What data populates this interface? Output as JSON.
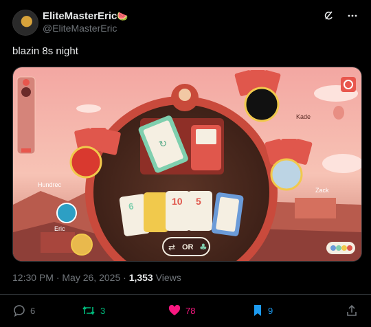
{
  "user": {
    "display_name": "EliteMasterEric",
    "emoji": "🍉",
    "handle": "@EliteMasterEric"
  },
  "tweet": {
    "text": "blazin 8s night",
    "time": "12:30 PM",
    "separator": "·",
    "date": "May 26, 2025",
    "separator2": "·",
    "views_count": "1,353",
    "views_label": "Views"
  },
  "actions": {
    "replies": "6",
    "retweets": "3",
    "likes": "78",
    "bookmarks": "9"
  },
  "game": {
    "players": {
      "kade": "Kade",
      "zack": "Zack",
      "hundrec": "Hundrec",
      "eric": "Eric"
    },
    "hand_cards": [
      "6",
      "",
      "10",
      "5",
      ""
    ],
    "wild_label": "OR",
    "colors": {
      "red": "#e0574c",
      "green": "#7fcfae",
      "blue": "#6b9bd8",
      "yellow": "#f1c94c",
      "ring": "#c94a3c"
    }
  },
  "icons": {
    "grok": "grok-icon",
    "more": "more-icon",
    "reply": "reply-icon",
    "retweet": "retweet-icon",
    "like": "heart-icon",
    "bookmark": "bookmark-icon",
    "share": "share-icon"
  }
}
